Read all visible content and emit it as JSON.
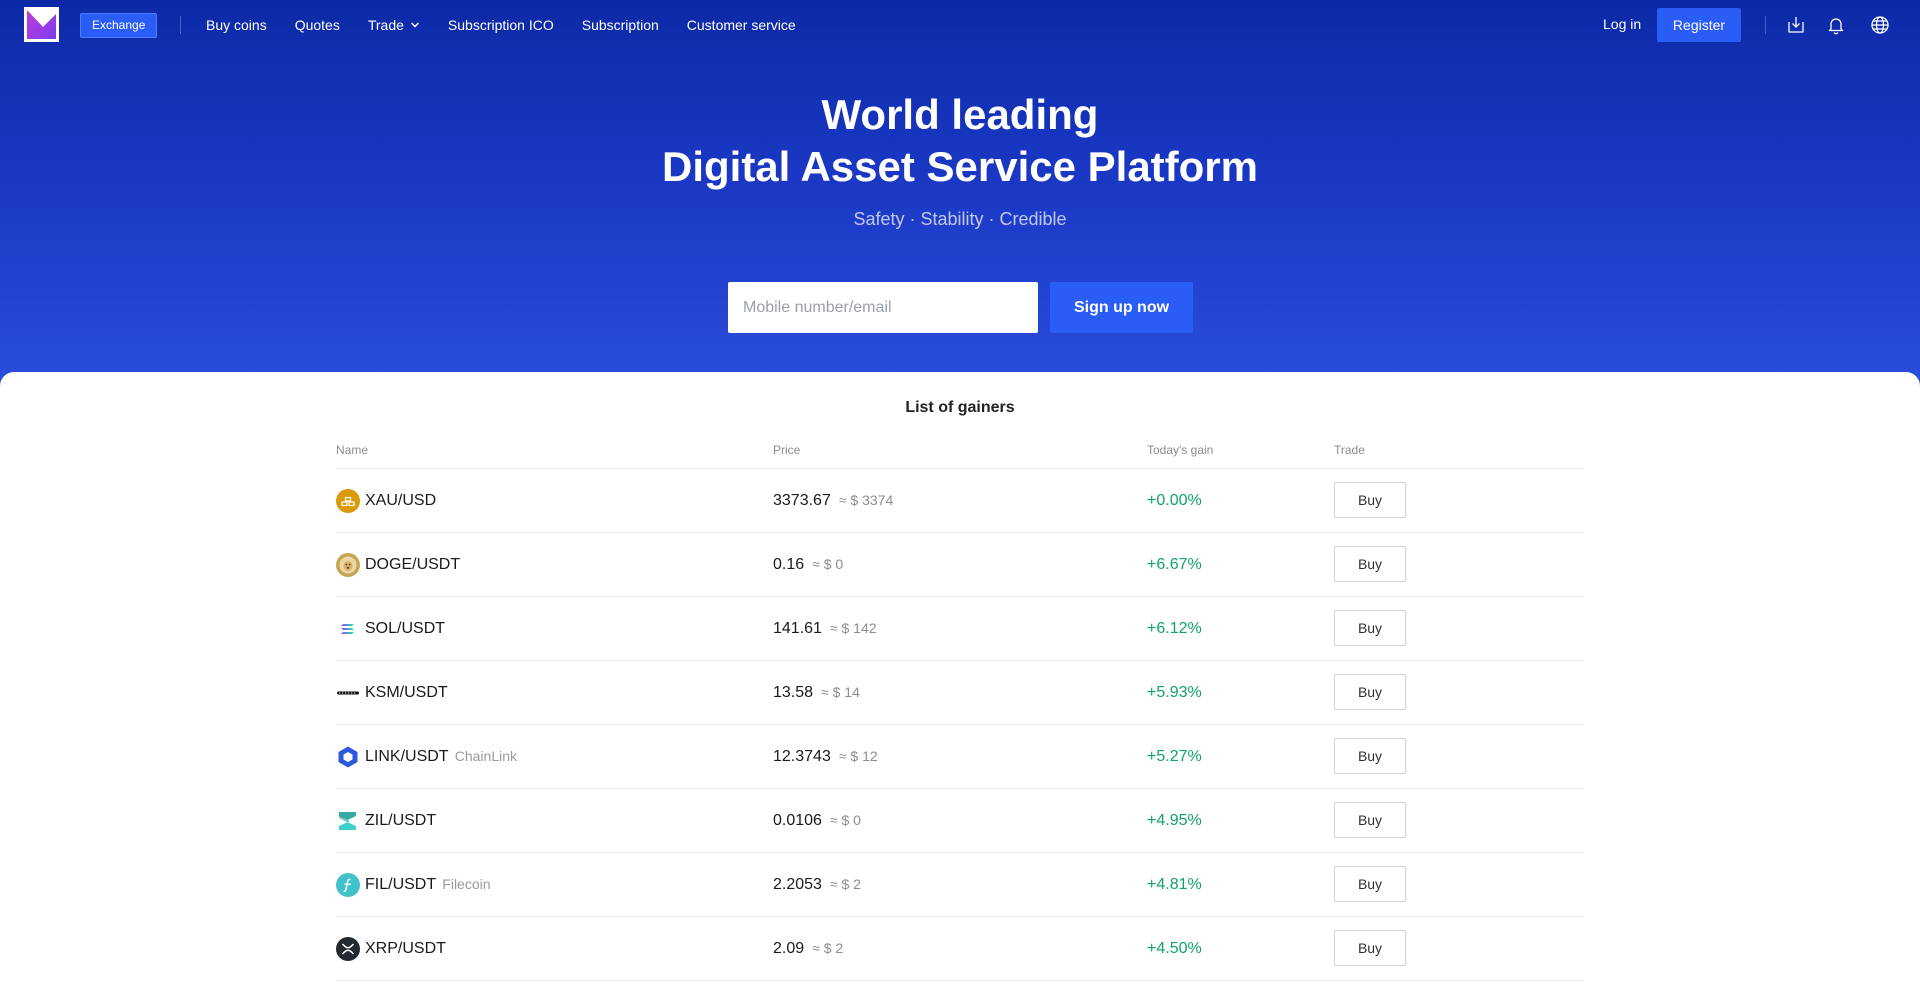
{
  "nav": {
    "exchange_label": "Exchange",
    "links": [
      "Buy coins",
      "Quotes",
      "Trade",
      "Subscription ICO",
      "Subscription",
      "Customer service"
    ],
    "login_label": "Log in",
    "register_label": "Register",
    "icons": [
      "download-icon",
      "bell-icon",
      "globe-icon"
    ]
  },
  "hero": {
    "title_line1": "World leading",
    "title_line2": "Digital Asset Service Platform",
    "subtitle": "Safety · Stability · Credible",
    "input_placeholder": "Mobile number/email",
    "signup_label": "Sign up now"
  },
  "gainers": {
    "title": "List of gainers",
    "headers": {
      "name": "Name",
      "price": "Price",
      "gain": "Today's gain",
      "trade": "Trade"
    },
    "rows": [
      {
        "icon": "gold-icon",
        "pair": "XAU/USD",
        "sub": "",
        "price": "3373.67",
        "approx": "≈ $ 3374",
        "gain": "+0.00%",
        "buy": "Buy"
      },
      {
        "icon": "dogecoin-icon",
        "pair": "DOGE/USDT",
        "sub": "",
        "price": "0.16",
        "approx": "≈ $ 0",
        "gain": "+6.67%",
        "buy": "Buy"
      },
      {
        "icon": "solana-icon",
        "pair": "SOL/USDT",
        "sub": "",
        "price": "141.61",
        "approx": "≈ $ 142",
        "gain": "+6.12%",
        "buy": "Buy"
      },
      {
        "icon": "kusama-icon",
        "pair": "KSM/USDT",
        "sub": "",
        "price": "13.58",
        "approx": "≈ $ 14",
        "gain": "+5.93%",
        "buy": "Buy"
      },
      {
        "icon": "chainlink-icon",
        "pair": "LINK/USDT",
        "sub": "ChainLink",
        "price": "12.3743",
        "approx": "≈ $ 12",
        "gain": "+5.27%",
        "buy": "Buy"
      },
      {
        "icon": "zilliqa-icon",
        "pair": "ZIL/USDT",
        "sub": "",
        "price": "0.0106",
        "approx": "≈ $ 0",
        "gain": "+4.95%",
        "buy": "Buy"
      },
      {
        "icon": "filecoin-icon",
        "pair": "FIL/USDT",
        "sub": "Filecoin",
        "price": "2.2053",
        "approx": "≈ $ 2",
        "gain": "+4.81%",
        "buy": "Buy"
      },
      {
        "icon": "xrp-icon",
        "pair": "XRP/USDT",
        "sub": "",
        "price": "2.09",
        "approx": "≈ $ 2",
        "gain": "+4.50%",
        "buy": "Buy"
      }
    ]
  },
  "colors": {
    "hero_top": "#0c2aa6",
    "hero_bottom": "#2b4fdc",
    "accent": "#2a5cf6",
    "gain_green": "#0fa36a"
  }
}
